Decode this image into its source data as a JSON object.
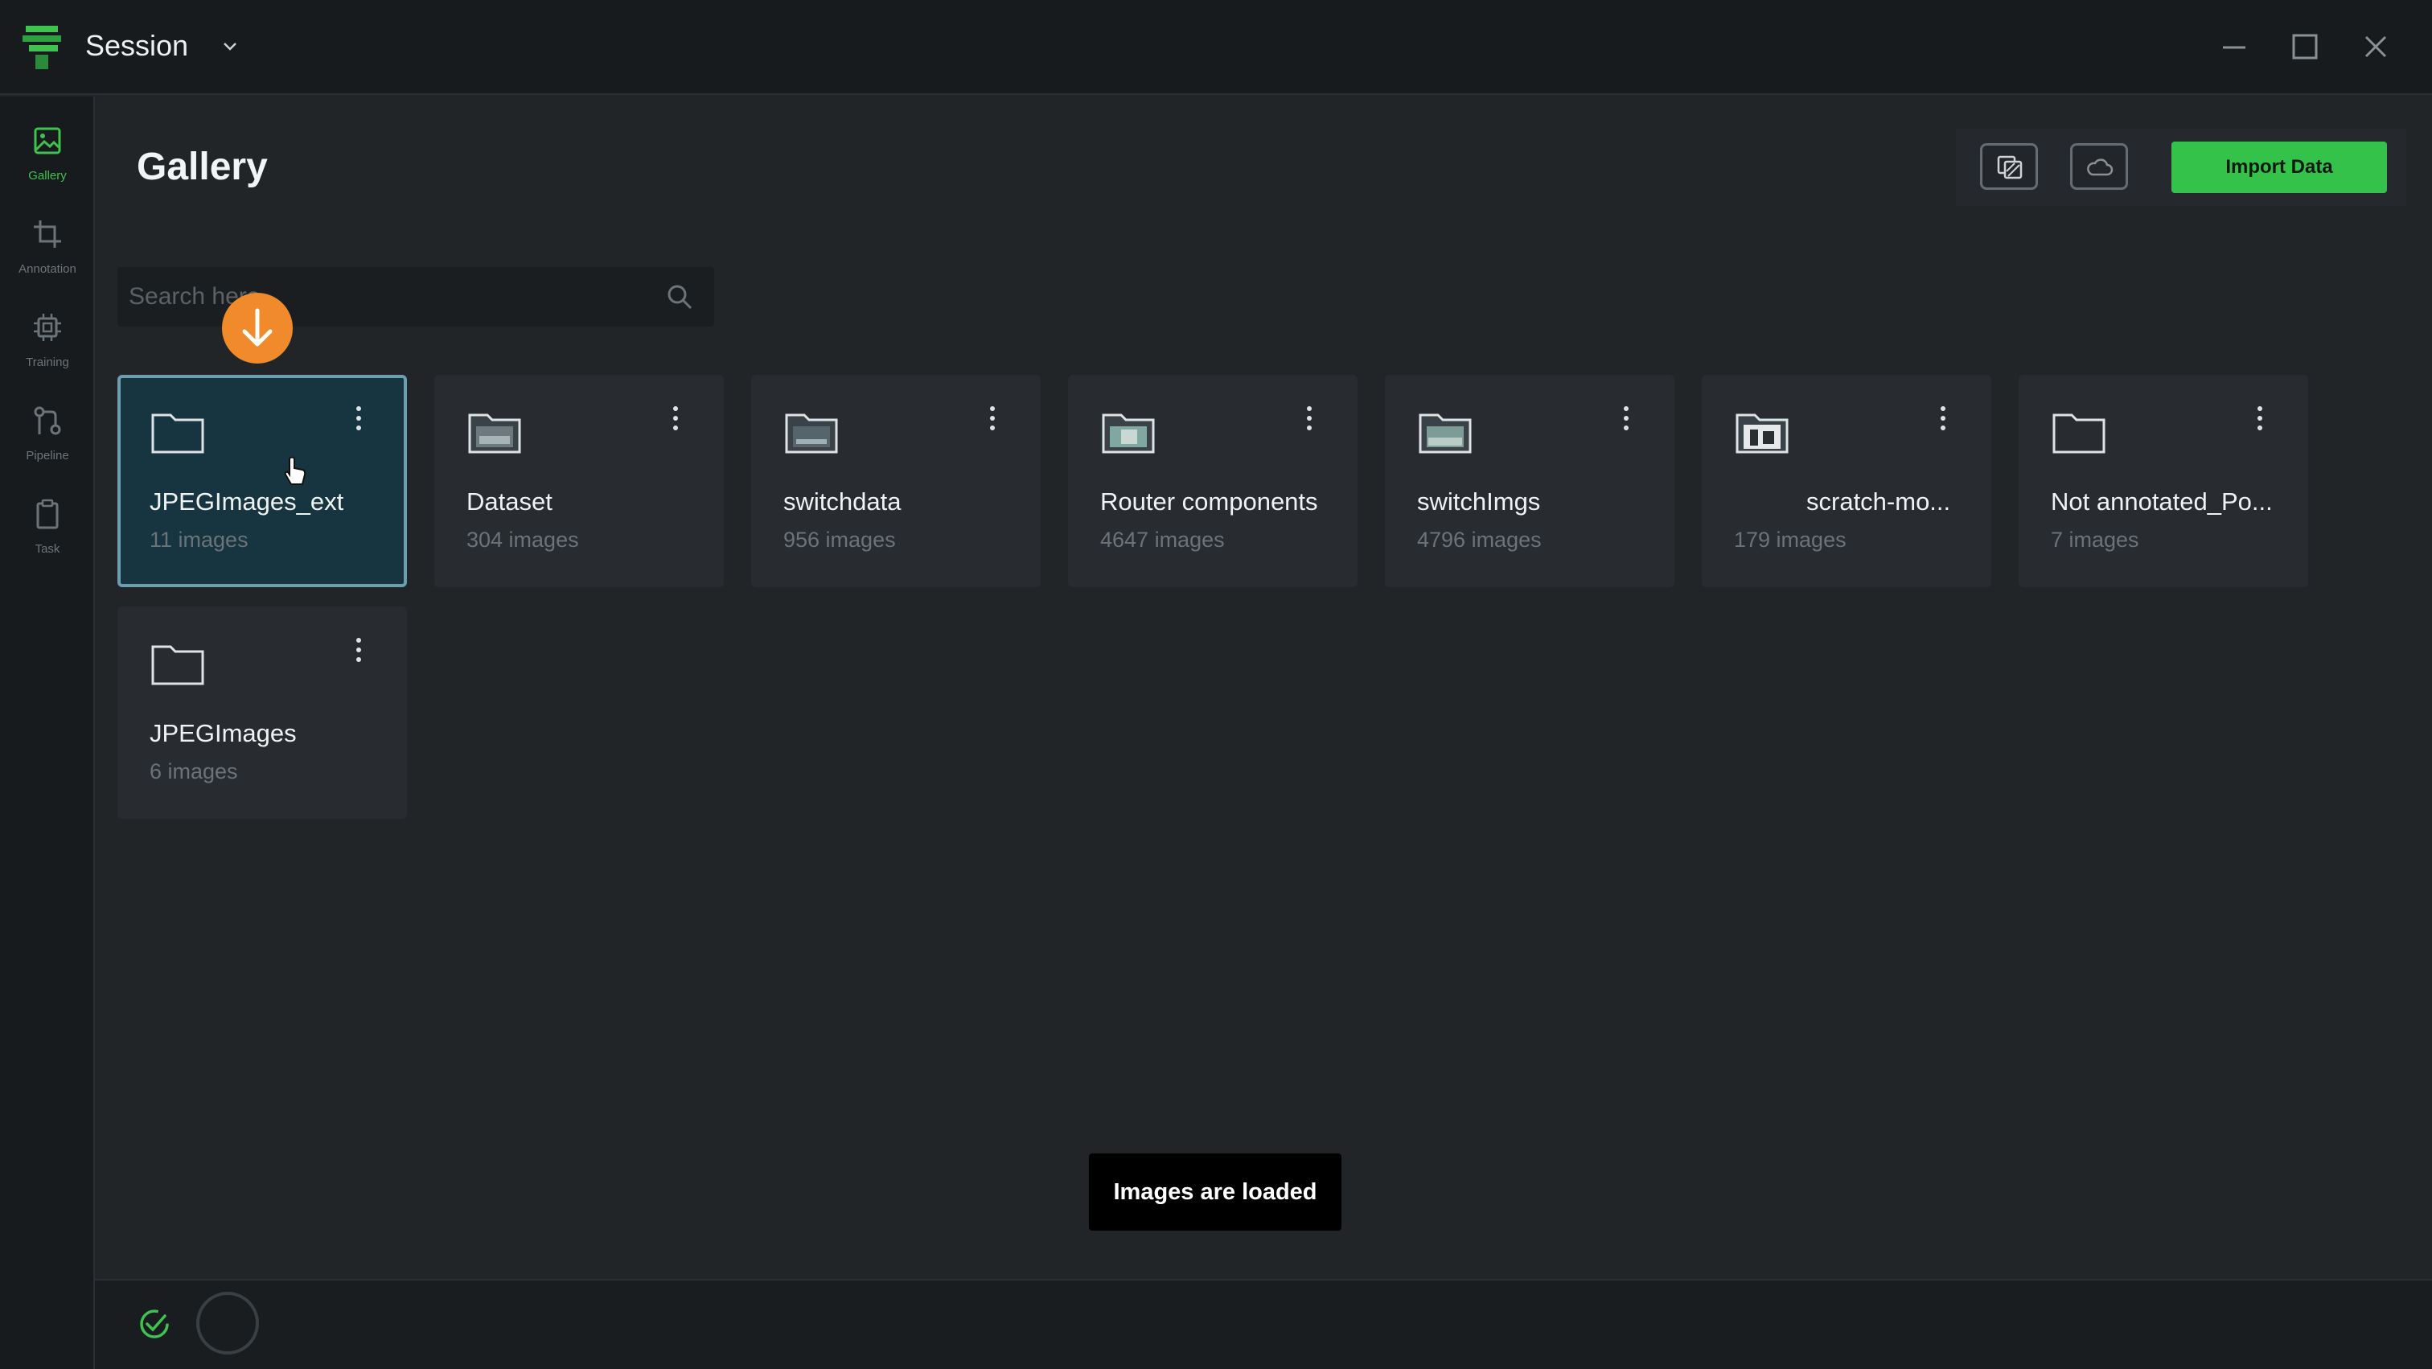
{
  "titlebar": {
    "title": "Session"
  },
  "sidebar": {
    "items": [
      {
        "label": "Gallery",
        "icon": "image-icon",
        "active": true
      },
      {
        "label": "Annotation",
        "icon": "crop-icon",
        "active": false
      },
      {
        "label": "Training",
        "icon": "chip-icon",
        "active": false
      },
      {
        "label": "Pipeline",
        "icon": "pipeline-icon",
        "active": false
      },
      {
        "label": "Task",
        "icon": "clipboard-icon",
        "active": false
      }
    ]
  },
  "main": {
    "title": "Gallery",
    "import_label": "Import Data",
    "search": {
      "placeholder": "Search here",
      "value": ""
    }
  },
  "datasets": [
    {
      "name": "JPEGImages_ext",
      "count": "11 images",
      "icon": "folder-icon",
      "selected": true
    },
    {
      "name": "Dataset",
      "count": "304 images",
      "icon": "folder-image-icon",
      "selected": false
    },
    {
      "name": "switchdata",
      "count": "956 images",
      "icon": "folder-image-icon",
      "selected": false
    },
    {
      "name": "Router components",
      "count": "4647 images",
      "icon": "folder-image-icon",
      "selected": false
    },
    {
      "name": "switchImgs",
      "count": "4796 images",
      "icon": "folder-image-icon",
      "selected": false
    },
    {
      "name": "scratch-mo...",
      "count": "179 images",
      "icon": "folder-image-icon",
      "selected": false
    },
    {
      "name": "Not annotated_Po...",
      "count": "7 images",
      "icon": "folder-icon",
      "selected": false
    },
    {
      "name": "JPEGImages",
      "count": "6 images",
      "icon": "folder-icon",
      "selected": false
    }
  ],
  "toast": {
    "message": "Images are loaded"
  },
  "colors": {
    "accent": "#34c24a",
    "background": "#212528",
    "selected_card": "#173540",
    "drag_indicator": "#f08a2a"
  }
}
